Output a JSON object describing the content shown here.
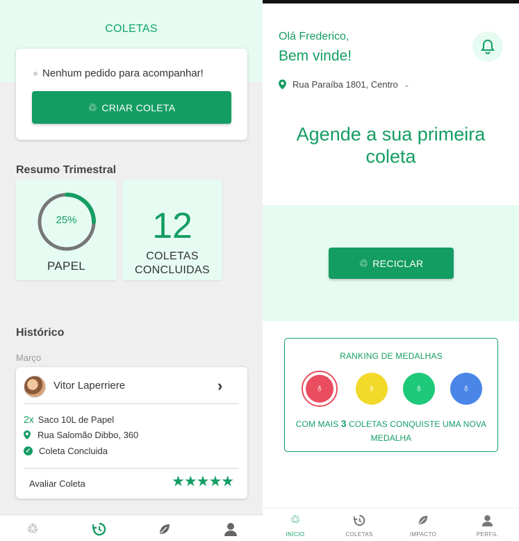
{
  "left": {
    "title": "COLETAS",
    "track_message": "Nenhum pedido para acompanhar!",
    "create_button": "CRIAR COLETA",
    "summary_title": "Resumo Trimestral",
    "paper_percent": "25%",
    "paper_progress": 0.25,
    "paper_label": "PAPEL",
    "count_value": "12",
    "count_label_line1": "COLETAS",
    "count_label_line2": "CONCLUIDAS",
    "history_title": "Histórico",
    "history_month": "Março",
    "history": {
      "person": "Vitor Laperriere",
      "qty": "2x",
      "item": "Saco 10L de Papel",
      "address": "Rua Salomão Dibbo, 360",
      "status": "Coleta Concluida",
      "rate_label": "Avaliar Coleta",
      "stars": "★★★★★"
    },
    "nav_icons": [
      "recycle-icon",
      "history-icon",
      "leaf-icon",
      "user-icon"
    ]
  },
  "right": {
    "greeting": "Olá Frederico,",
    "welcome": "Bem vinde!",
    "address": "Rua Paraíba 1801, Centro",
    "headline_line1": "Agende a sua primeira",
    "headline_line2": "coleta",
    "recycle_button": "RECICLAR",
    "medal_title": "RANKING DE MEDALHAS",
    "medal_msg_prefix": "COM MAIS",
    "medal_msg_count": "3",
    "medal_msg_suffix": "COLETAS CONQUISTE UMA NOVA",
    "medal_msg_line2": "MEDALHA",
    "medal_colors": [
      "#e94d5f",
      "#f2d92a",
      "#1ec97a",
      "#4a86e8"
    ],
    "nav": [
      {
        "label": "INÍCIO",
        "icon": "recycle-icon",
        "active": true
      },
      {
        "label": "COLETAS",
        "icon": "history-icon",
        "active": false
      },
      {
        "label": "IMPACTO",
        "icon": "leaf-icon",
        "active": false
      },
      {
        "label": "PERFIL",
        "icon": "user-icon",
        "active": false
      }
    ]
  },
  "colors": {
    "brand_green": "#149d63",
    "mint": "#e6fbf2"
  }
}
